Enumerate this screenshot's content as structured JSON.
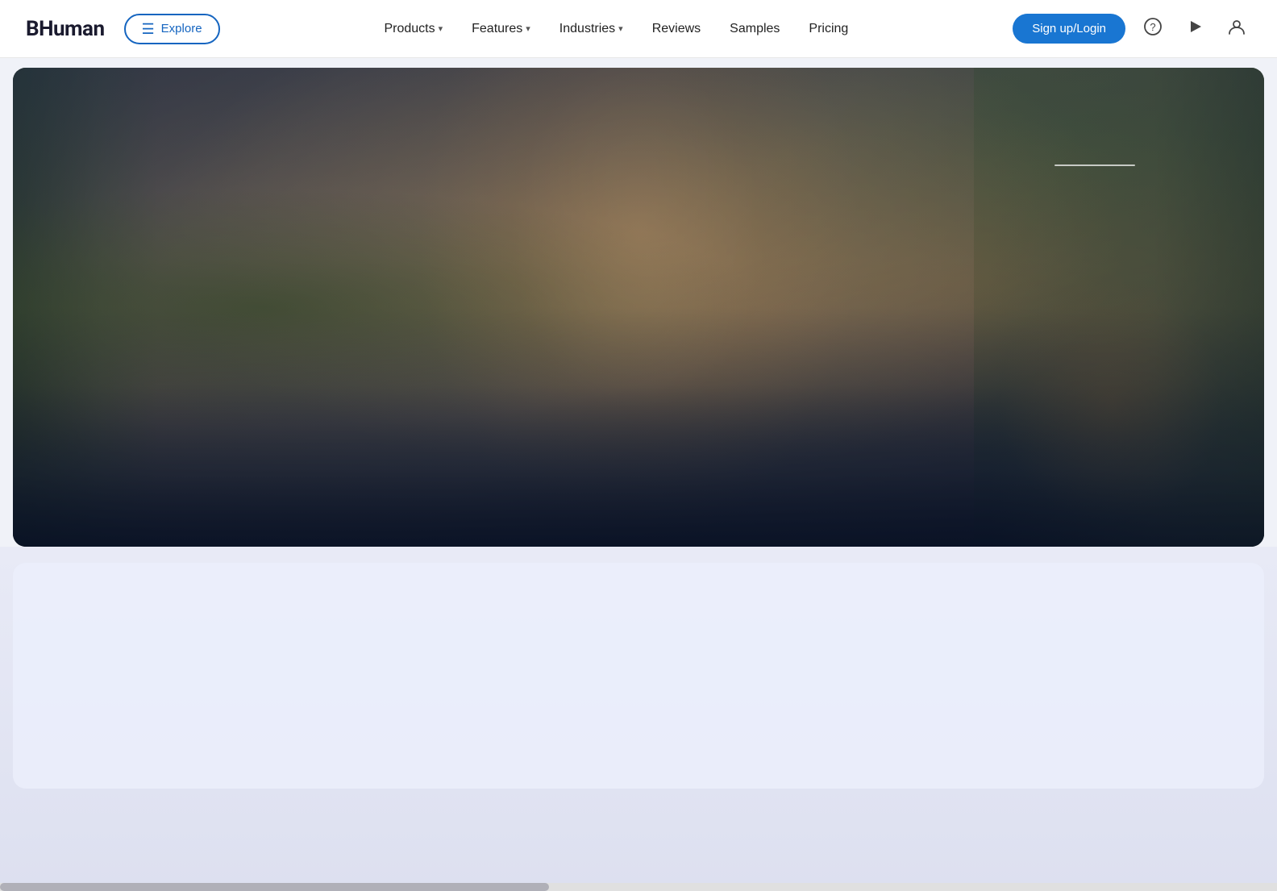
{
  "brand": {
    "name": "BHuman"
  },
  "nav": {
    "explore_label": "Explore",
    "items": [
      {
        "id": "products",
        "label": "Products",
        "has_dropdown": true
      },
      {
        "id": "features",
        "label": "Features",
        "has_dropdown": true
      },
      {
        "id": "industries",
        "label": "Industries",
        "has_dropdown": true
      },
      {
        "id": "reviews",
        "label": "Reviews",
        "has_dropdown": false
      },
      {
        "id": "samples",
        "label": "Samples",
        "has_dropdown": false
      },
      {
        "id": "pricing",
        "label": "Pricing",
        "has_dropdown": false
      }
    ],
    "signup_label": "Sign up/Login"
  },
  "hero": {
    "indicator_line": true
  },
  "below_hero": {
    "content": ""
  },
  "icons": {
    "hamburger": "☰",
    "help": "?",
    "play": "▶",
    "user": "👤",
    "chevron_down": "▾"
  }
}
